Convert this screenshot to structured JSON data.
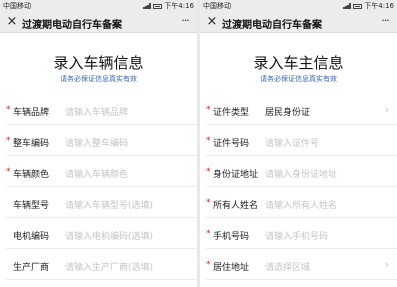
{
  "status": {
    "carrier": "中国移动",
    "time": "下午4:16"
  },
  "nav": {
    "title": "过渡期电动自行车备案",
    "close_icon": "×",
    "more_icon": "···"
  },
  "vehicle": {
    "title": "录入车辆信息",
    "subtitle": "请务必保证信息真实有效",
    "fields": [
      {
        "required": true,
        "label": "车辆品牌",
        "placeholder": "请输入车辆品牌"
      },
      {
        "required": true,
        "label": "整车编码",
        "placeholder": "请输入整车编码"
      },
      {
        "required": true,
        "label": "车辆颜色",
        "placeholder": "请输入车辆颜色"
      },
      {
        "required": false,
        "label": "车辆型号",
        "placeholder": "请输入车辆型号(选填)"
      },
      {
        "required": false,
        "label": "电机编码",
        "placeholder": "请输入电机编码(选填)"
      },
      {
        "required": false,
        "label": "生产厂商",
        "placeholder": "请输入生产厂商(选填)"
      }
    ]
  },
  "owner": {
    "title": "录入车主信息",
    "subtitle": "请务必保证信息真实有效",
    "fields": [
      {
        "required": true,
        "label": "证件类型",
        "value": "居民身份证",
        "chevron": "›"
      },
      {
        "required": true,
        "label": "证件号码",
        "placeholder": "请输入证件号"
      },
      {
        "required": true,
        "label": "身份证地址",
        "placeholder": "请输入身份证地址"
      },
      {
        "required": true,
        "label": "所有人姓名",
        "placeholder": "请输入所有人姓名"
      },
      {
        "required": true,
        "label": "手机号码",
        "placeholder": "请输入手机号码"
      },
      {
        "required": true,
        "label": "居住地址",
        "placeholder": "请选择区域",
        "chevron": "›"
      }
    ]
  },
  "icons": {
    "required_mark": "*",
    "signal": "signal-icon",
    "wifi": "wifi-icon",
    "battery": "battery-icon"
  },
  "colors": {
    "accent_blue": "#3a66b8",
    "required_red": "#e02020",
    "placeholder": "#c4c4c4"
  }
}
